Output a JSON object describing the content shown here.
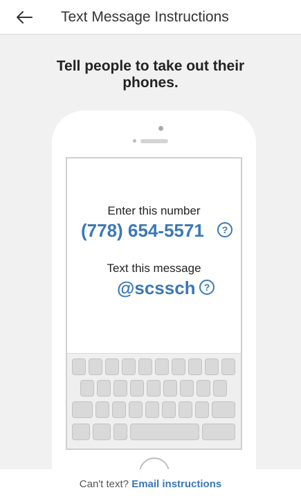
{
  "header": {
    "title": "Text Message Instructions",
    "back_icon": "arrow-left-icon"
  },
  "instruction": {
    "text": "Tell people to take out their phones."
  },
  "phone_screen": {
    "number_label": "Enter this number",
    "number_value": "(778) 654-5571",
    "message_label": "Text this message",
    "message_value": "@scssch",
    "help_symbol": "?"
  },
  "footer": {
    "prompt": "Can't text?",
    "link_label": "Email instructions"
  },
  "colors": {
    "accent": "#3a78b5",
    "background": "#f1f1f1"
  }
}
